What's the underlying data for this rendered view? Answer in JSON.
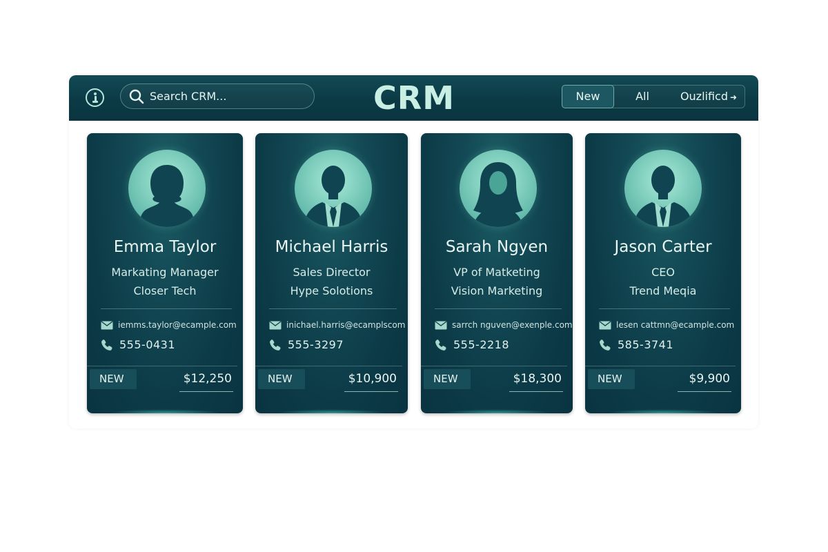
{
  "header": {
    "title": "CRM",
    "search": {
      "placeholder": "Search CRM..."
    },
    "filters": [
      {
        "label": "New",
        "active": true
      },
      {
        "label": "All",
        "active": false
      },
      {
        "label": "Ouzlificd",
        "active": false,
        "arrow": "➜"
      }
    ]
  },
  "icons": {
    "info": "info-icon",
    "search": "search-icon",
    "email": "mail-icon",
    "phone": "phone-icon"
  },
  "colors": {
    "header_bg": "#0b3a45",
    "card_bg": "#0c3a47",
    "accent": "#c9efe4"
  },
  "contacts": [
    {
      "name": "Emma Taylor",
      "role": "Markating Manager",
      "company": "Closer Tech",
      "email": "iemms.taylor@ecample.com",
      "phone": "555-0431",
      "status": "NEW",
      "value": "$12,250",
      "avatar": "female-short-hair"
    },
    {
      "name": "Michael Harris",
      "role": "Sales Director",
      "company": "Hype Solotions",
      "email": "inichael.harris@ecamplscom",
      "phone": "555-3297",
      "status": "NEW",
      "value": "$10,900",
      "avatar": "male-suit"
    },
    {
      "name": "Sarah Ngyen",
      "role": "VP of Matketing",
      "company": "Vision Marketing",
      "email": "sarrch nguven@exenple.com",
      "phone": "555-2218",
      "status": "NEW",
      "value": "$18,300",
      "avatar": "female-long-hair"
    },
    {
      "name": "Jason Carter",
      "role": "CEO",
      "company": "Trend Meqia",
      "email": "lesen cattmn@ecample.com",
      "phone": "585-3741",
      "status": "NEW",
      "value": "$9,900",
      "avatar": "male-suit"
    }
  ]
}
